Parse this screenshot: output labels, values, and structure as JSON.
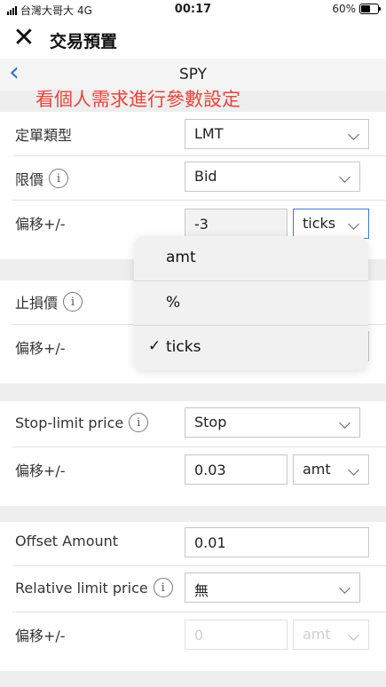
{
  "status_bar": {
    "carrier": "台灣大哥大",
    "network": "4G",
    "time": "00:17",
    "battery": "60%",
    "battery_level": 0.6
  },
  "header": {
    "close_icon": "close-icon",
    "title": "交易預置"
  },
  "nav": {
    "back_icon": "chevron-left-icon",
    "symbol": "SPY"
  },
  "annotation": "看個人需求進行參數設定",
  "order_type": {
    "label": "定單類型",
    "value": "LMT"
  },
  "limit_price": {
    "label": "限價",
    "value": "Bid"
  },
  "limit_offset": {
    "label": "偏移+/-",
    "value": "-3",
    "unit": "ticks"
  },
  "dropdown": {
    "items": [
      "amt",
      "%",
      "ticks"
    ],
    "selected": "ticks",
    "check": "✓"
  },
  "stop_price": {
    "label": "止損價"
  },
  "stop_offset": {
    "label": "偏移+/-"
  },
  "stop_limit_price": {
    "label": "Stop-limit price",
    "value": "Stop"
  },
  "stop_limit_offset": {
    "label": "偏移+/-",
    "value": "0.03",
    "unit": "amt"
  },
  "offset_amount": {
    "label": "Offset Amount",
    "value": "0.01"
  },
  "relative_limit_price": {
    "label": "Relative limit price",
    "value": "無"
  },
  "relative_offset": {
    "label": "偏移+/-",
    "placeholder": "0",
    "unit": "amt"
  },
  "info_glyph": "i"
}
